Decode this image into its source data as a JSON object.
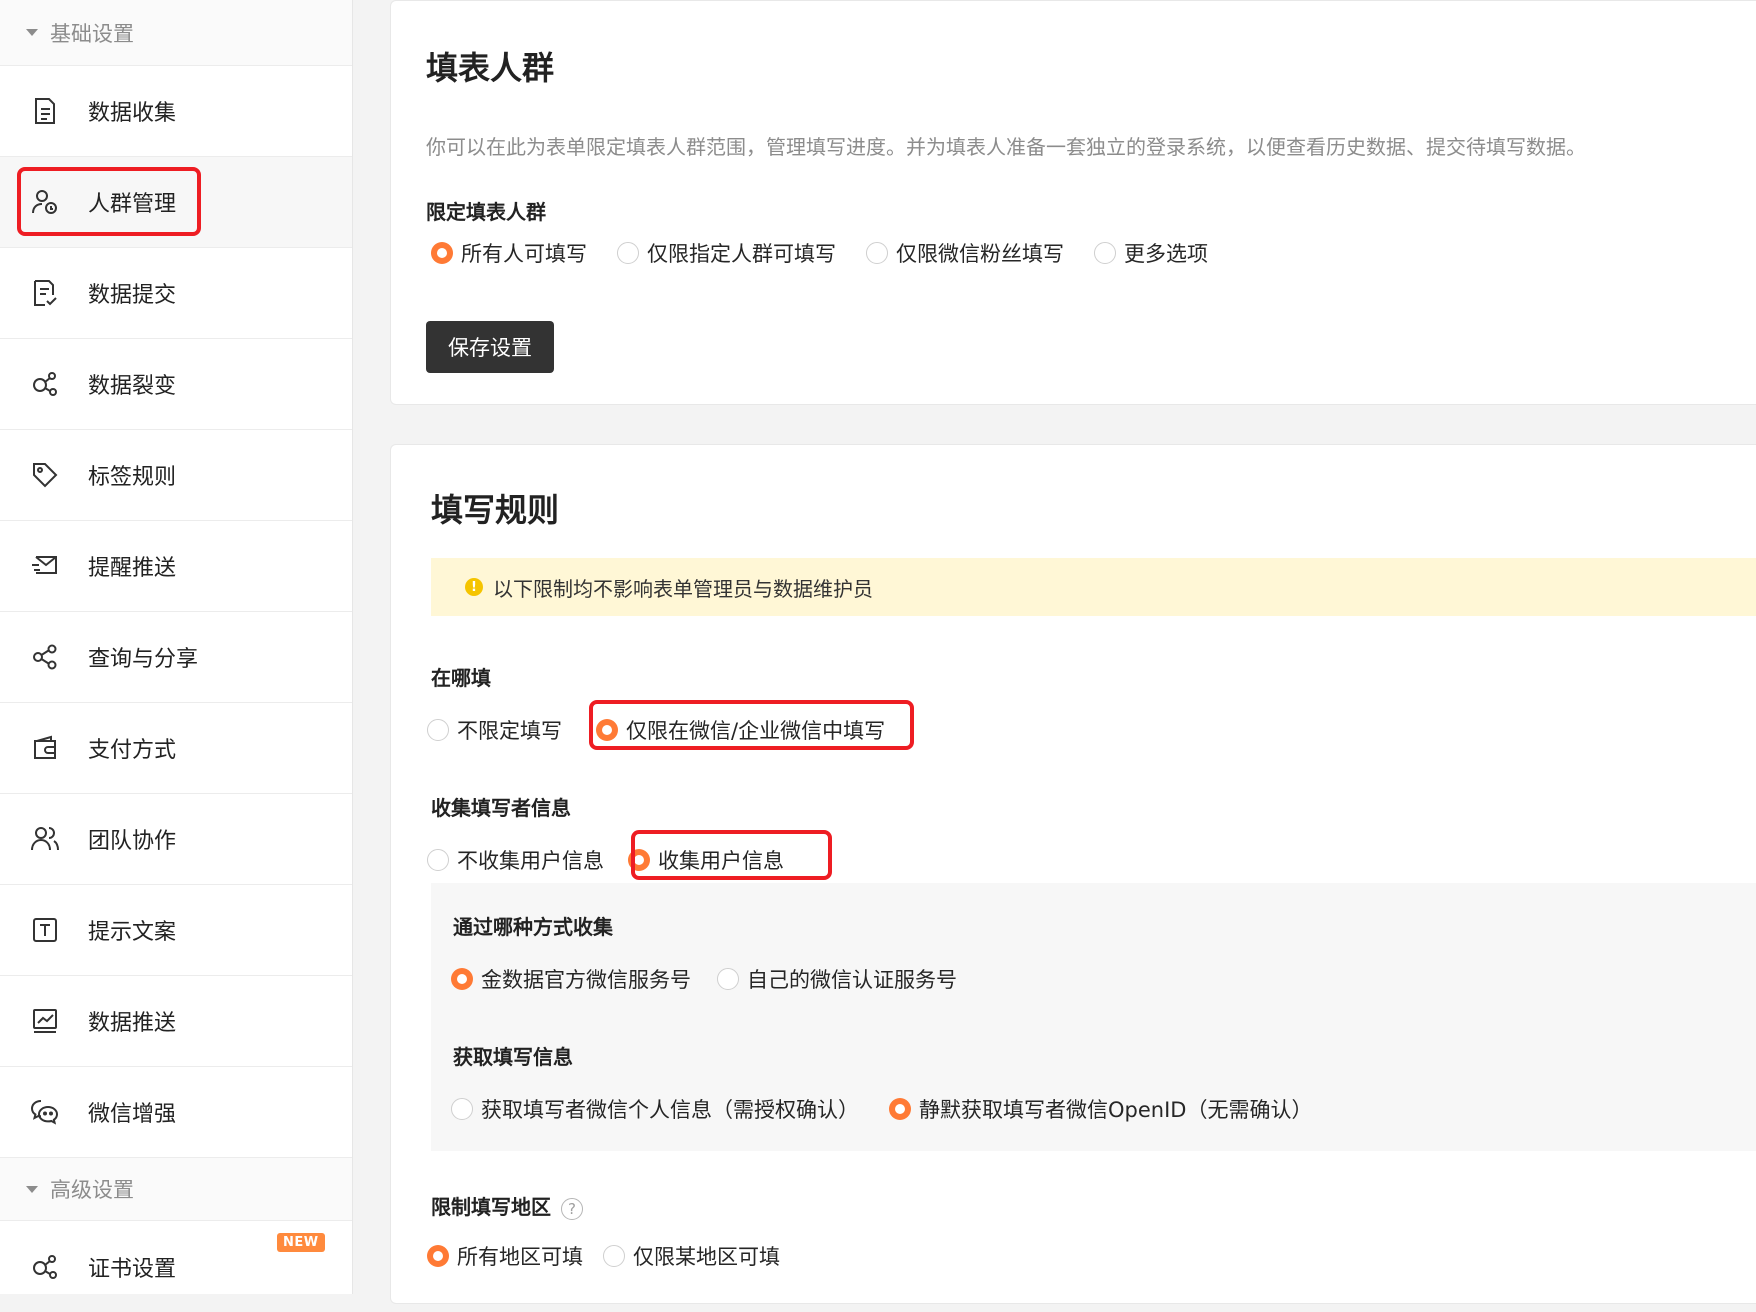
{
  "sidebar": {
    "group_basic": "基础设置",
    "group_advanced": "高级设置",
    "items": [
      {
        "label": "数据收集",
        "icon": "document-icon"
      },
      {
        "label": "人群管理",
        "icon": "user-settings-icon"
      },
      {
        "label": "数据提交",
        "icon": "document-check-icon"
      },
      {
        "label": "数据裂变",
        "icon": "fission-icon"
      },
      {
        "label": "标签规则",
        "icon": "tag-icon"
      },
      {
        "label": "提醒推送",
        "icon": "send-icon"
      },
      {
        "label": "查询与分享",
        "icon": "share-icon"
      },
      {
        "label": "支付方式",
        "icon": "wallet-icon"
      },
      {
        "label": "团队协作",
        "icon": "team-icon"
      },
      {
        "label": "提示文案",
        "icon": "text-icon"
      },
      {
        "label": "数据推送",
        "icon": "chart-icon"
      },
      {
        "label": "微信增强",
        "icon": "wechat-icon"
      }
    ],
    "advanced_items": [
      {
        "label": "证书设置",
        "icon": "fission-icon",
        "badge": "NEW"
      }
    ]
  },
  "crowd": {
    "title": "填表人群",
    "description": "你可以在此为表单限定填表人群范围，管理填写进度。并为填表人准备一套独立的登录系统，以便查看历史数据、提交待填写数据。",
    "limit_label": "限定填表人群",
    "options": [
      "所有人可填写",
      "仅限指定人群可填写",
      "仅限微信粉丝填写",
      "更多选项"
    ],
    "selected": 0,
    "save_label": "保存设置"
  },
  "rules": {
    "title": "填写规则",
    "notice": "以下限制均不影响表单管理员与数据维护员",
    "where_label": "在哪填",
    "where_options": [
      "不限定填写",
      "仅限在微信/企业微信中填写"
    ],
    "where_selected": 1,
    "collect_label": "收集填写者信息",
    "collect_options": [
      "不收集用户信息",
      "收集用户信息"
    ],
    "collect_selected": 1,
    "method_label": "通过哪种方式收集",
    "method_options": [
      "金数据官方微信服务号",
      "自己的微信认证服务号"
    ],
    "method_selected": 0,
    "fetch_label": "获取填写信息",
    "fetch_options": [
      "获取填写者微信个人信息（需授权确认）",
      "静默获取填写者微信OpenID（无需确认）"
    ],
    "fetch_selected": 1,
    "region_label": "限制填写地区",
    "region_help": "?",
    "region_options": [
      "所有地区可填",
      "仅限某地区可填"
    ],
    "region_selected": 0
  },
  "colors": {
    "accent": "#ff7a35",
    "highlight": "#ee1d23",
    "button": "#333333",
    "notice_bg": "#fff7d6"
  }
}
